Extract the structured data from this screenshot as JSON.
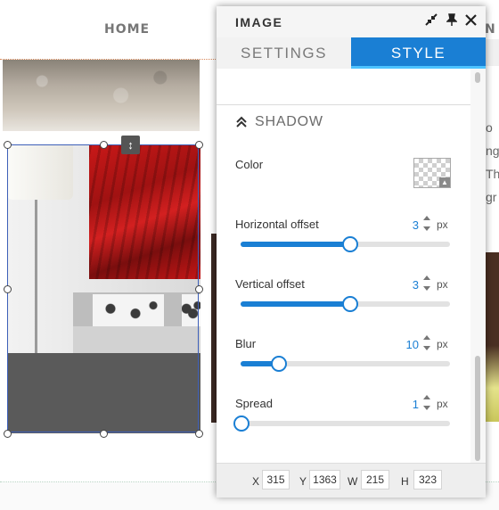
{
  "site": {
    "nav_home": "HOME",
    "nav_partial": "N",
    "right_text_lines": [
      "o",
      "ng",
      "Th",
      "gr"
    ]
  },
  "panel": {
    "title": "IMAGE",
    "icons": [
      "collapse-icon",
      "pin-icon",
      "close-icon"
    ],
    "tabs": [
      {
        "label": "SETTINGS",
        "active": false
      },
      {
        "label": "STYLE",
        "active": true
      }
    ],
    "section": {
      "title": "SHADOW",
      "expanded": true
    },
    "color": {
      "label": "Color",
      "value": "transparent"
    },
    "sliders": [
      {
        "label": "Horizontal offset",
        "value": "3",
        "unit": "px",
        "fraction": 0.52
      },
      {
        "label": "Vertical offset",
        "value": "3",
        "unit": "px",
        "fraction": 0.52
      },
      {
        "label": "Blur",
        "value": "10",
        "unit": "px",
        "fraction": 0.18
      },
      {
        "label": "Spread",
        "value": "1",
        "unit": "px",
        "fraction": 0.0
      }
    ],
    "footer": {
      "x_label": "X",
      "x_value": "315",
      "y_label": "Y",
      "y_value": "1363",
      "w_label": "W",
      "w_value": "215",
      "h_label": "H",
      "h_value": "323"
    }
  },
  "colors": {
    "accent": "#1a7fd4",
    "tab_underline": "#4dc3ff",
    "selection": "#3d5fb8"
  }
}
